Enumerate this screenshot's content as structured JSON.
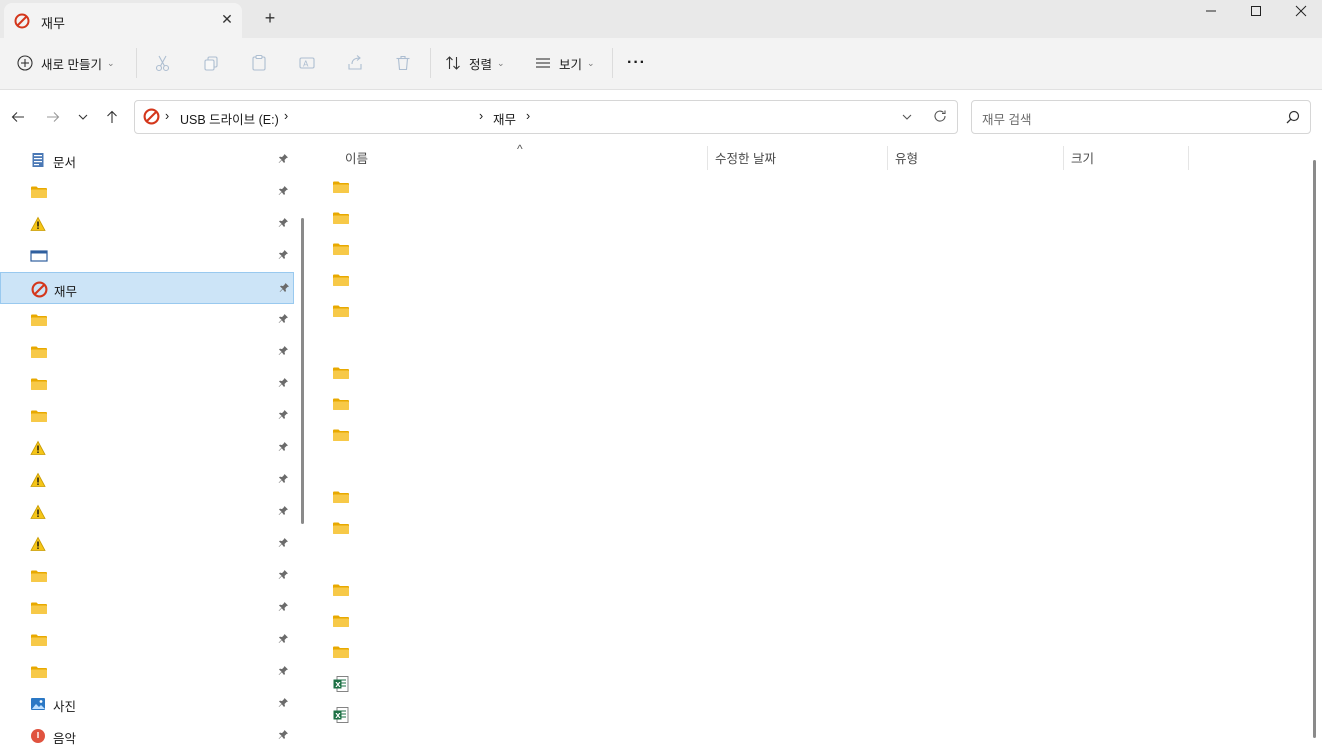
{
  "window": {
    "tab_title": "재무",
    "new_tab": "+",
    "close_tab": "✕"
  },
  "toolbar": {
    "new_label": "새로 만들기",
    "sort_label": "정렬",
    "view_label": "보기",
    "more_label": "···"
  },
  "address": {
    "breadcrumbs": [
      "USB 드라이브 (E:)",
      "재무"
    ]
  },
  "search": {
    "placeholder": "재무 검색"
  },
  "sidebar": {
    "items": [
      {
        "icon": "document-icon",
        "label": "문서"
      },
      {
        "icon": "folder-icon",
        "label": ""
      },
      {
        "icon": "warning-icon",
        "label": ""
      },
      {
        "icon": "window-icon",
        "label": ""
      },
      {
        "icon": "no-entry-icon",
        "label": "재무",
        "selected": true
      },
      {
        "icon": "folder-icon",
        "label": ""
      },
      {
        "icon": "folder-icon",
        "label": ""
      },
      {
        "icon": "folder-icon",
        "label": ""
      },
      {
        "icon": "folder-icon",
        "label": ""
      },
      {
        "icon": "warning-icon",
        "label": ""
      },
      {
        "icon": "warning-icon",
        "label": ""
      },
      {
        "icon": "warning-icon",
        "label": ""
      },
      {
        "icon": "warning-icon",
        "label": ""
      },
      {
        "icon": "folder-icon",
        "label": ""
      },
      {
        "icon": "folder-icon",
        "label": ""
      },
      {
        "icon": "folder-icon",
        "label": ""
      },
      {
        "icon": "folder-icon",
        "label": ""
      },
      {
        "icon": "pictures-icon",
        "label": "사진"
      },
      {
        "icon": "music-icon",
        "label": "음악"
      }
    ]
  },
  "file_list": {
    "columns": [
      "이름",
      "수정한 날짜",
      "유형",
      "크기"
    ],
    "sort_indicator": "^",
    "rows": [
      {
        "icon": "folder-icon"
      },
      {
        "icon": "folder-icon"
      },
      {
        "icon": "folder-icon"
      },
      {
        "icon": "folder-icon"
      },
      {
        "icon": "folder-icon"
      },
      {
        "icon": "blank"
      },
      {
        "icon": "folder-icon"
      },
      {
        "icon": "folder-icon"
      },
      {
        "icon": "folder-icon"
      },
      {
        "icon": "blank"
      },
      {
        "icon": "folder-icon"
      },
      {
        "icon": "folder-icon"
      },
      {
        "icon": "blank"
      },
      {
        "icon": "folder-icon"
      },
      {
        "icon": "folder-icon"
      },
      {
        "icon": "folder-icon"
      },
      {
        "icon": "excel-file-icon"
      },
      {
        "icon": "excel-file-icon"
      }
    ]
  },
  "colors": {
    "folder": "#f7c948",
    "warning": "#f5c518",
    "no_entry": "#d4371c",
    "selected_bg": "#cce4f7",
    "excel": "#1e7145"
  }
}
